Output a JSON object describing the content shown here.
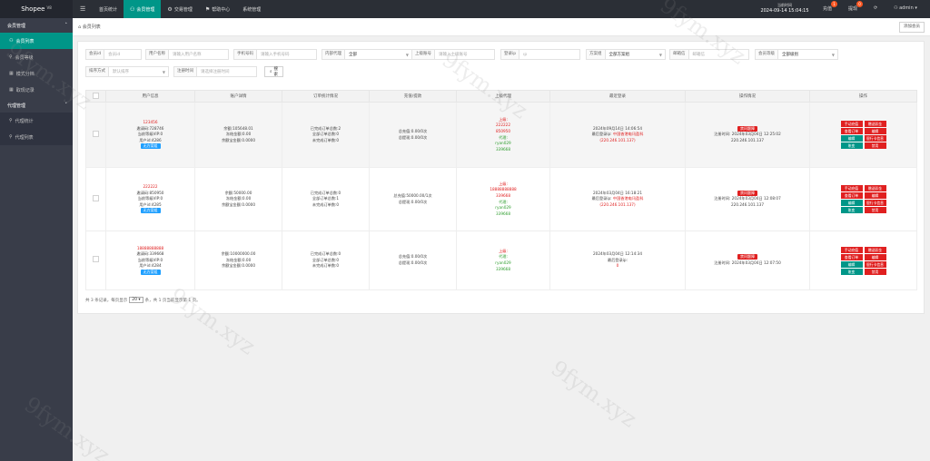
{
  "brand": {
    "name": "Shopee",
    "version": "V8"
  },
  "topnav": [
    {
      "label": "首页统计",
      "icon": ""
    },
    {
      "label": "会员管理",
      "icon": "user-icon"
    },
    {
      "label": "交易管理",
      "icon": "gear-icon"
    },
    {
      "label": "帮助中心",
      "icon": "flag-icon"
    },
    {
      "label": "系统管理",
      "icon": ""
    }
  ],
  "topright": {
    "clock_label": "当前时间",
    "clock_time": "2024-09-14 15:04:15",
    "recharge": "充值",
    "recharge_badge": "1",
    "withdraw": "提现",
    "withdraw_badge": "0",
    "user": "admin"
  },
  "sidebar": {
    "group1": "会员管理",
    "items": [
      "会员列表",
      "会员等级",
      "模式分档",
      "取现记录"
    ],
    "group2": "代理管理",
    "sub_items": [
      "代理统计",
      "代理列表"
    ]
  },
  "tab": {
    "label": "会员列表",
    "add_button": "添加会员"
  },
  "filters": {
    "account": {
      "label": "会员id",
      "placeholder": "会员id"
    },
    "username": {
      "label": "用户名称",
      "placeholder": "请输入用户名称"
    },
    "phone": {
      "label": "手机号码",
      "placeholder": "请输入手机号码"
    },
    "agent": {
      "label": "内部代理",
      "value": "全部"
    },
    "parent": {
      "label": "上级账号",
      "placeholder": "请输入上级账号"
    },
    "login_ip": {
      "label": "登录ip",
      "placeholder": "ip"
    },
    "scheme": {
      "label": "方案组",
      "value": "全部方案组"
    },
    "mail": {
      "label": "邮箱信",
      "placeholder": "邮箱信"
    },
    "level": {
      "label": "会员等级",
      "value": "全部级别"
    },
    "sort": {
      "label": "排序方式",
      "placeholder": "默认排序"
    },
    "reg_time": {
      "label": "注册时间",
      "placeholder": "请选择注册时间"
    },
    "search_button": "搜 索"
  },
  "table": {
    "headers": [
      "用户信息",
      "账户详情",
      "订单统计情况",
      "充值/提款",
      "上级代理",
      "最近登录",
      "操作情况",
      "操作"
    ],
    "rows": [
      {
        "name": "123456",
        "code": "邀请码:728746",
        "vip": "当前等级VIP:0",
        "uid": "用户id:4286",
        "tag": "无方案组",
        "balance": "余额:105648.01",
        "frozen": "冻结金额:0.00",
        "interest": "余额宝金额:0.0000",
        "orders1": "已完成订单总数:2",
        "orders2": "全部订单总数:0",
        "orders3": "未完成订单数:0",
        "recharge": "总充值:0.00/0次",
        "withdraw": "总提现:0.00/0次",
        "parent_label": "上级:",
        "parent1": "222222",
        "parent2": "850950",
        "agent_label": "代理:",
        "agent1": "ryan029",
        "agent2": "339668",
        "login_time": "2024年09月14日 14:06:54",
        "login_ip_label": "最后登录ip:",
        "login_ip_loc": "中国香港电讯盈科",
        "login_ip": "(220.246.101.137)",
        "op_tag": "禁问题障",
        "reg_label": "注册时间:",
        "reg_time": "2024年03月04日 12:25:02",
        "reg_ip": "220.246.101.137"
      },
      {
        "name": "222222",
        "code": "邀请码:850950",
        "vip": "当前等级VIP:0",
        "uid": "用户id:4285",
        "tag": "无方案组",
        "balance": "余额:50000.00",
        "frozen": "冻结金额:0.00",
        "interest": "余额宝金额:0.0000",
        "orders1": "已完成订单总数:0",
        "orders2": "全部订单总数:1",
        "orders3": "未完成订单数:0",
        "recharge": "总充值:50000.00/1次",
        "withdraw": "总提现:0.00/0次",
        "parent_label": "上级:",
        "parent1": "18888888888",
        "parent2": "339668",
        "agent_label": "代理:",
        "agent1": "ryan029",
        "agent2": "339668",
        "login_time": "2024年03月04日 16:18:21",
        "login_ip_label": "最后登录ip:",
        "login_ip_loc": "中国香港电讯盈科",
        "login_ip": "(220.246.101.137)",
        "op_tag": "禁问题障",
        "reg_label": "注册时间:",
        "reg_time": "2024年03月04日 12:08:07",
        "reg_ip": "220.246.101.137"
      },
      {
        "name": "18888888888",
        "code": "邀请码:339668",
        "vip": "当前等级VIP:0",
        "uid": "用户id:4284",
        "tag": "无方案组",
        "balance": "余额:10000000.00",
        "frozen": "冻结金额:0.00",
        "interest": "余额宝金额:0.0000",
        "orders1": "已完成订单总数:0",
        "orders2": "全部订单总数:0",
        "orders3": "未完成订单数:0",
        "recharge": "总充值:0.00/0次",
        "withdraw": "总提现:0.00/0次",
        "parent_label": "上级:",
        "parent1": "",
        "parent2": "",
        "agent_label": "代理:",
        "agent1": "ryan029",
        "agent2": "339668",
        "login_time": "2024年03月04日 12:14:34",
        "login_ip_label": "最后登录ip:",
        "login_ip_loc": "",
        "login_ip": "0",
        "op_tag": "禁问题障",
        "reg_label": "注册时间:",
        "reg_time": "2024年03月04日 12:07:50",
        "reg_ip": ""
      }
    ],
    "op_buttons": [
      {
        "label": "手动充值",
        "color": "#e02020"
      },
      {
        "label": "赠送彩金",
        "color": "#e02020"
      },
      {
        "label": "查看订单",
        "color": "#e02020"
      },
      {
        "label": "编辑",
        "color": "#e02020"
      },
      {
        "label": "编辑",
        "color": "#009688"
      },
      {
        "label": "银行卡信息",
        "color": "#e02020"
      },
      {
        "label": "账变",
        "color": "#009688"
      },
      {
        "label": "禁用",
        "color": "#e02020"
      }
    ]
  },
  "pager": {
    "prefix": "共 3 条记录，每页显示",
    "page_size": "20",
    "suffix": "条，共 1 页当前显示第 1 页。"
  },
  "watermark": "9fym.xyz",
  "colors": {
    "accent": "#009688",
    "topbar": "#2b2f36",
    "sidebar": "#393d49",
    "danger": "#e02020",
    "info": "#1e9fff"
  }
}
